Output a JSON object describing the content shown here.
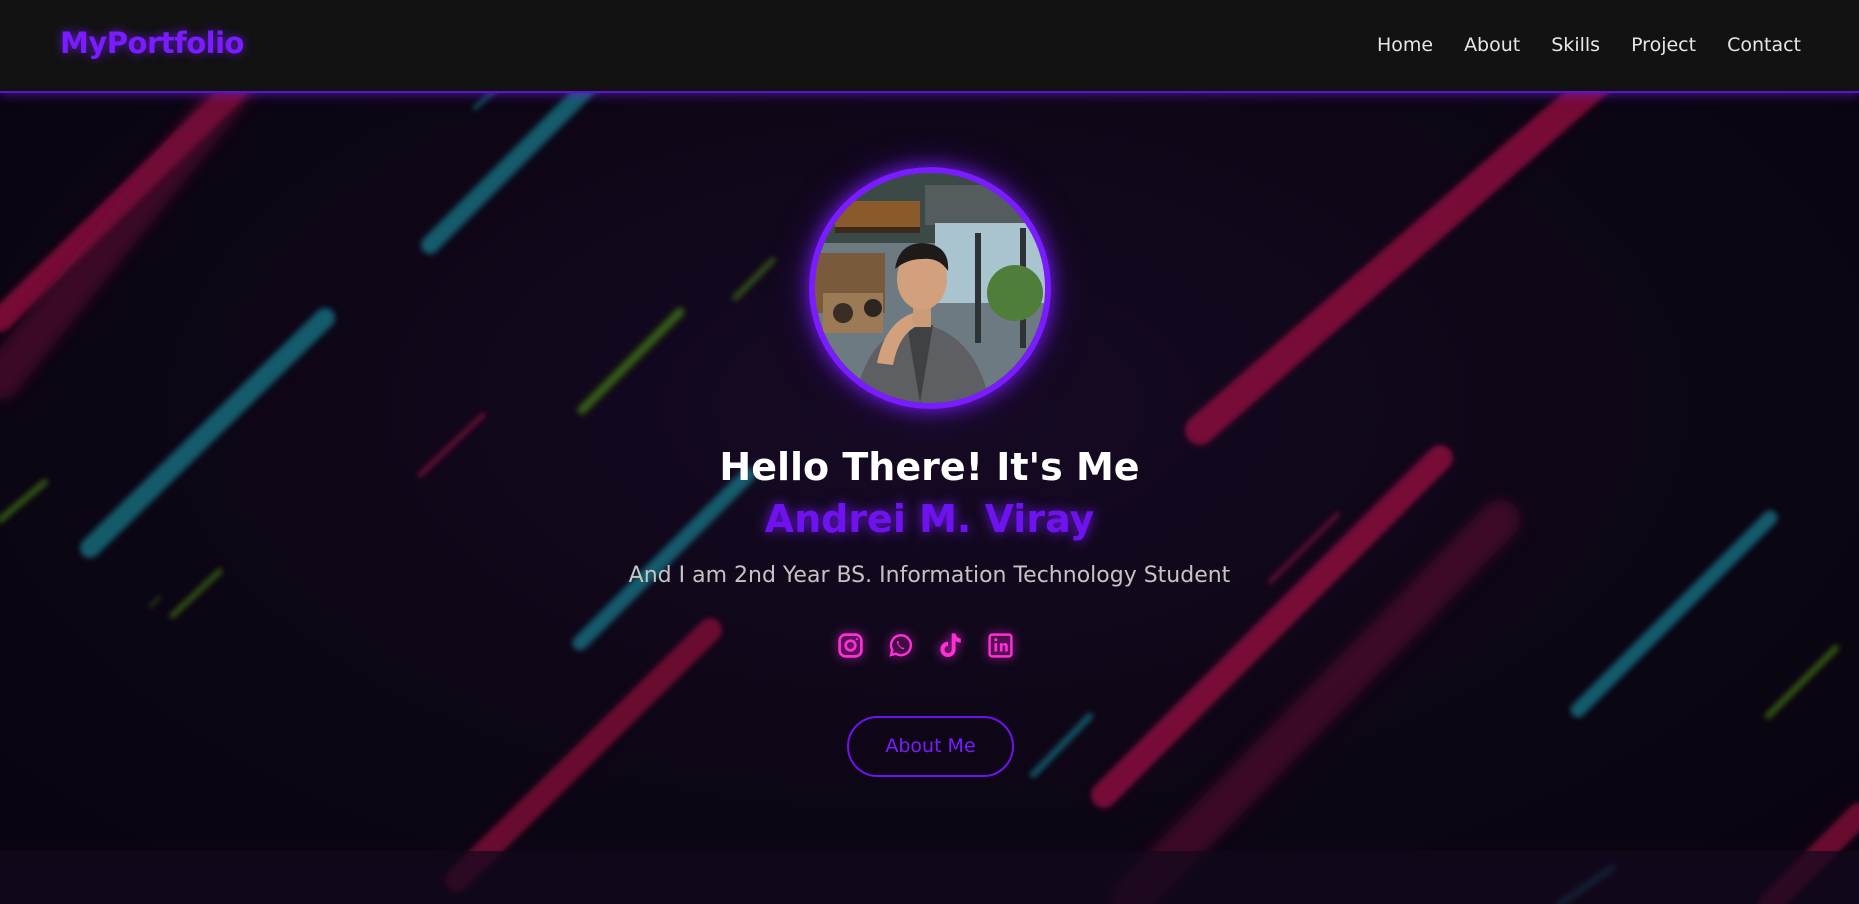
{
  "navbar": {
    "logo": "MyPortfolio",
    "links": [
      {
        "label": "Home"
      },
      {
        "label": "About"
      },
      {
        "label": "Skills"
      },
      {
        "label": "Project"
      },
      {
        "label": "Contact"
      }
    ]
  },
  "hero": {
    "title": "Hello There! It's Me",
    "name": "Andrei M. Viray",
    "subtitle": "And I am 2nd Year BS. Information Technology Student",
    "button_label": "About Me",
    "socials": [
      {
        "icon": "instagram-icon"
      },
      {
        "icon": "whatsapp-icon"
      },
      {
        "icon": "tiktok-icon"
      },
      {
        "icon": "linkedin-icon"
      }
    ]
  },
  "colors": {
    "accent": "#7a1cff",
    "social": "#ff2fd6",
    "navbar_bg": "#121212",
    "background": "#0d0615"
  }
}
